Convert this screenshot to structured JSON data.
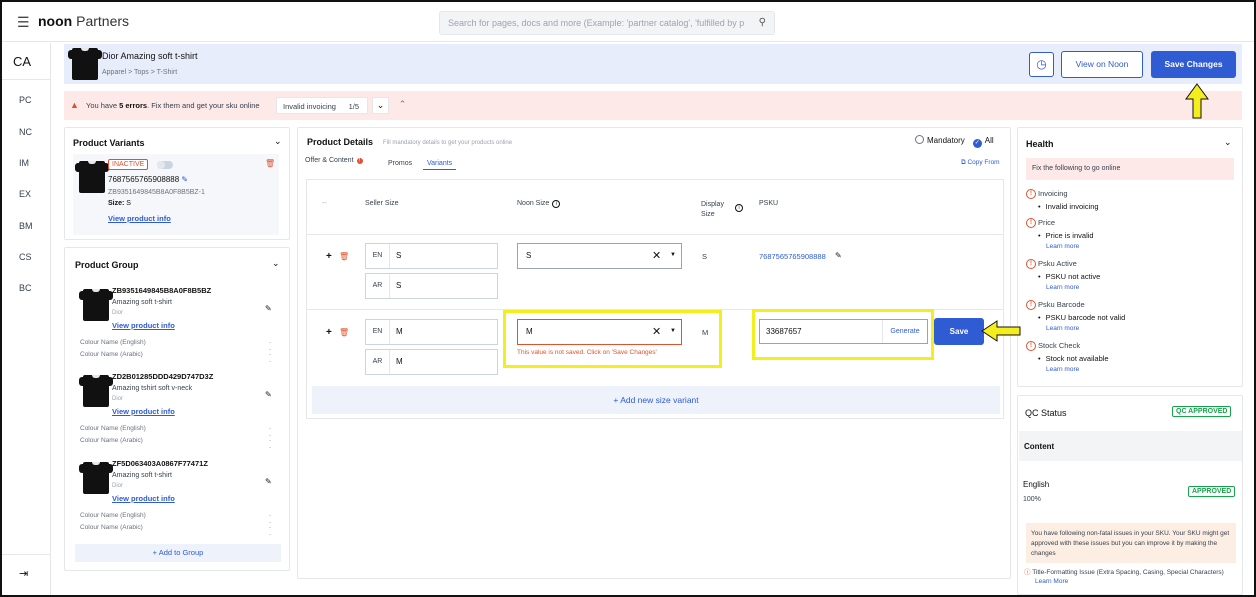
{
  "topbar": {
    "brand_main": "noon",
    "brand_sub": "Partners",
    "search_placeholder": "Search for pages, docs and more (Example: 'partner catalog', 'fulfilled by p"
  },
  "leftnav": {
    "current": "CA",
    "items": [
      "PC",
      "NC",
      "IM",
      "EX",
      "BM",
      "CS",
      "BC"
    ],
    "collapse_icon": "expand-sidebar-icon"
  },
  "product": {
    "title": "Dior Amazing soft t-shirt",
    "breadcrumb": "Apparel > Tops > T-Shirt",
    "view_on_noon": "View on Noon",
    "save_changes": "Save Changes"
  },
  "errors": {
    "prefix": "You have ",
    "count": "5 errors",
    "suffix": ". Fix them and get your sku online",
    "current_error": "Invalid invoicing",
    "pager": "1/5"
  },
  "variants_card": {
    "title": "Product Variants",
    "status": "INACTIVE",
    "psku": "7687565765908888",
    "zsku": "ZB9351649845B8A0F8B5BZ-1",
    "size_label": "Size:",
    "size": "S",
    "link": "View product info"
  },
  "group_card": {
    "title": "Product Group",
    "items": [
      {
        "sku": "ZB9351649845B8A0F8B5BZ",
        "name": "Amazing soft t-shirt",
        "brand": "Dior",
        "link": "View product info",
        "c1": "Colour Name (English)",
        "c2": "Colour Name (Arabic)",
        "dash": "--"
      },
      {
        "sku": "ZD2B01285DDD429D747D3Z",
        "name": "Amazing tshirt soft v-neck",
        "brand": "Dior",
        "link": "View product info",
        "c1": "Colour Name (English)",
        "c2": "Colour Name (Arabic)",
        "dash": "--"
      },
      {
        "sku": "ZF5D063403A0867F77471Z",
        "name": "Amazing soft t-shirt",
        "brand": "Dior",
        "link": "View product info",
        "c1": "Colour Name (English)",
        "c2": "Colour Name (Arabic)",
        "dash": "--"
      }
    ],
    "add": "+ Add to Group"
  },
  "details": {
    "title": "Product Details",
    "subtitle": "Fill mandatory details to get your products online",
    "mandatory": "Mandatory",
    "all": "All",
    "copy_from": "Copy From",
    "tabs": [
      "Offer & Content",
      "Promos",
      "Variants"
    ],
    "headers": {
      "dash": "--",
      "seller": "Seller Size",
      "noon": "Noon Size",
      "display": "Display Size",
      "psku": "PSKU"
    },
    "rows": [
      {
        "en_code": "EN",
        "en": "S",
        "ar_code": "AR",
        "ar": "S",
        "noon": "S",
        "display": "S",
        "psku": "7687565765908888"
      },
      {
        "en_code": "EN",
        "en": "M",
        "ar_code": "AR",
        "ar": "M",
        "noon": "M",
        "display": "M",
        "error": "This value is not saved. Click on 'Save Changes'",
        "psku_input": "33687657",
        "generate": "Generate",
        "save": "Save"
      }
    ],
    "add_variant": "+  Add new size variant"
  },
  "health": {
    "title": "Health",
    "fix": "Fix the following to go online",
    "items": [
      {
        "name": "Invoicing",
        "detail": "Invalid invoicing",
        "more": ""
      },
      {
        "name": "Price",
        "detail": "Price is invalid",
        "more": "Learn more"
      },
      {
        "name": "Psku Active",
        "detail": "PSKU not active",
        "more": "Learn more"
      },
      {
        "name": "Psku Barcode",
        "detail": "PSKU barcode not valid",
        "more": "Learn more"
      },
      {
        "name": "Stock Check",
        "detail": "Stock not available",
        "more": "Learn more"
      }
    ]
  },
  "qc": {
    "title": "QC Status",
    "badge": "QC APPROVED",
    "content": "Content",
    "lang": "English",
    "pct": "100%",
    "lang_badge": "APPROVED",
    "note": "You have following non-fatal issues in your SKU. Your SKU might get approved with these issues but you can improve it by making the changes",
    "issue": "Title-Formatting Issue (Extra Spacing, Casing, Special Characters)",
    "issue_more": "Learn More"
  },
  "colors": {
    "primary": "#2f5bd3",
    "error": "#e0522e",
    "highlight": "#f4ee1d",
    "success": "#16a34a"
  }
}
